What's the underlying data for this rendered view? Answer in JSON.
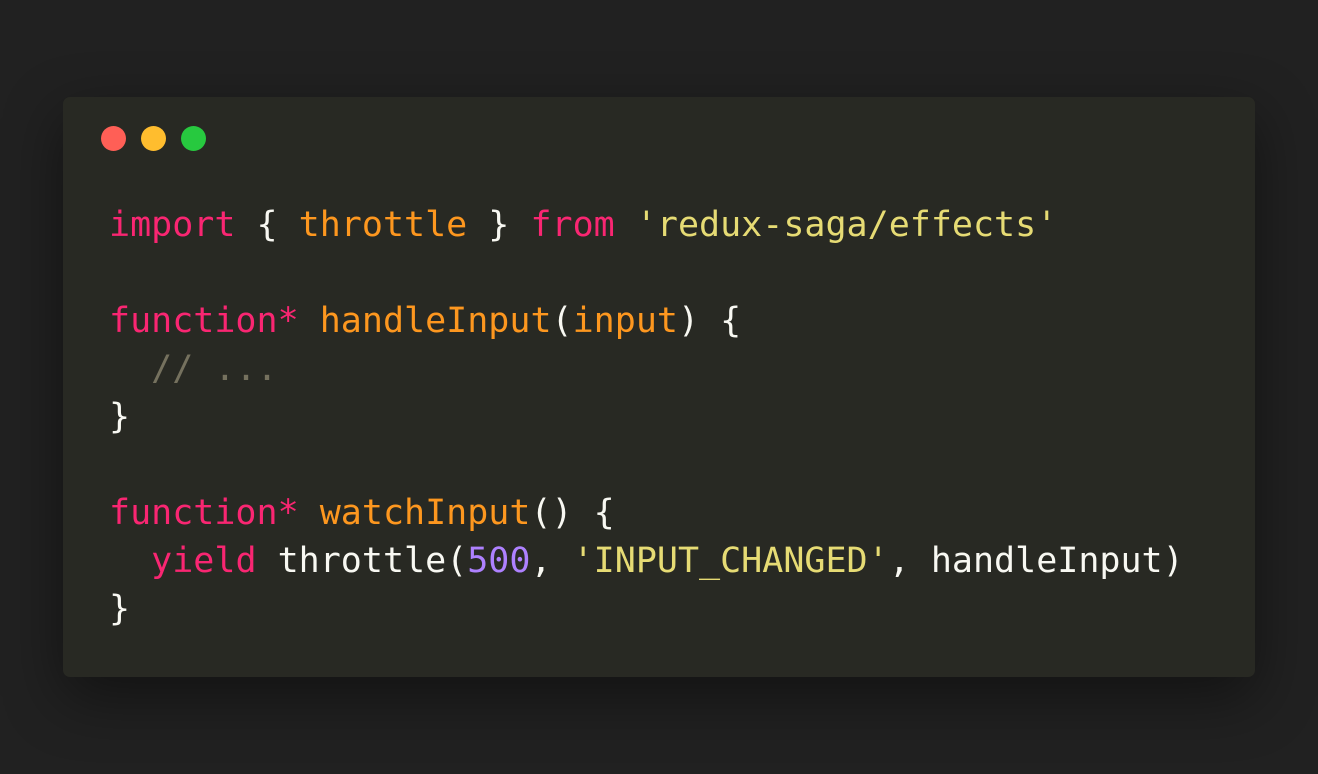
{
  "colors": {
    "page_background": "#212121",
    "window_background": "#282923",
    "dot_close": "#ff5f56",
    "dot_minimize": "#ffbd2e",
    "dot_maximize": "#27c93f",
    "keyword": "#f92672",
    "function_name": "#fd971f",
    "string": "#e6db74",
    "number": "#ae81ff",
    "comment": "#75715e",
    "plain": "#f8f8f2"
  },
  "window_controls": [
    {
      "name": "close-dot-icon",
      "color": "#ff5f56"
    },
    {
      "name": "minimize-dot-icon",
      "color": "#ffbd2e"
    },
    {
      "name": "maximize-dot-icon",
      "color": "#27c93f"
    }
  ],
  "code_lines": [
    [
      {
        "text": "import",
        "kind": "keyword"
      },
      {
        "text": " { ",
        "kind": "plain"
      },
      {
        "text": "throttle",
        "kind": "function_name"
      },
      {
        "text": " } ",
        "kind": "plain"
      },
      {
        "text": "from",
        "kind": "keyword"
      },
      {
        "text": " ",
        "kind": "plain"
      },
      {
        "text": "'redux-saga/effects'",
        "kind": "string"
      }
    ],
    [],
    [
      {
        "text": "function*",
        "kind": "keyword"
      },
      {
        "text": " ",
        "kind": "plain"
      },
      {
        "text": "handleInput",
        "kind": "function_name"
      },
      {
        "text": "(",
        "kind": "plain"
      },
      {
        "text": "input",
        "kind": "function_name"
      },
      {
        "text": ") {",
        "kind": "plain"
      }
    ],
    [
      {
        "text": "  ",
        "kind": "plain"
      },
      {
        "text": "// ...",
        "kind": "comment"
      }
    ],
    [
      {
        "text": "}",
        "kind": "plain"
      }
    ],
    [],
    [
      {
        "text": "function*",
        "kind": "keyword"
      },
      {
        "text": " ",
        "kind": "plain"
      },
      {
        "text": "watchInput",
        "kind": "function_name"
      },
      {
        "text": "() {",
        "kind": "plain"
      }
    ],
    [
      {
        "text": "  ",
        "kind": "plain"
      },
      {
        "text": "yield",
        "kind": "keyword"
      },
      {
        "text": " throttle(",
        "kind": "plain"
      },
      {
        "text": "500",
        "kind": "number"
      },
      {
        "text": ", ",
        "kind": "plain"
      },
      {
        "text": "'INPUT_CHANGED'",
        "kind": "string"
      },
      {
        "text": ", handleInput)",
        "kind": "plain"
      }
    ],
    [
      {
        "text": "}",
        "kind": "plain"
      }
    ]
  ]
}
